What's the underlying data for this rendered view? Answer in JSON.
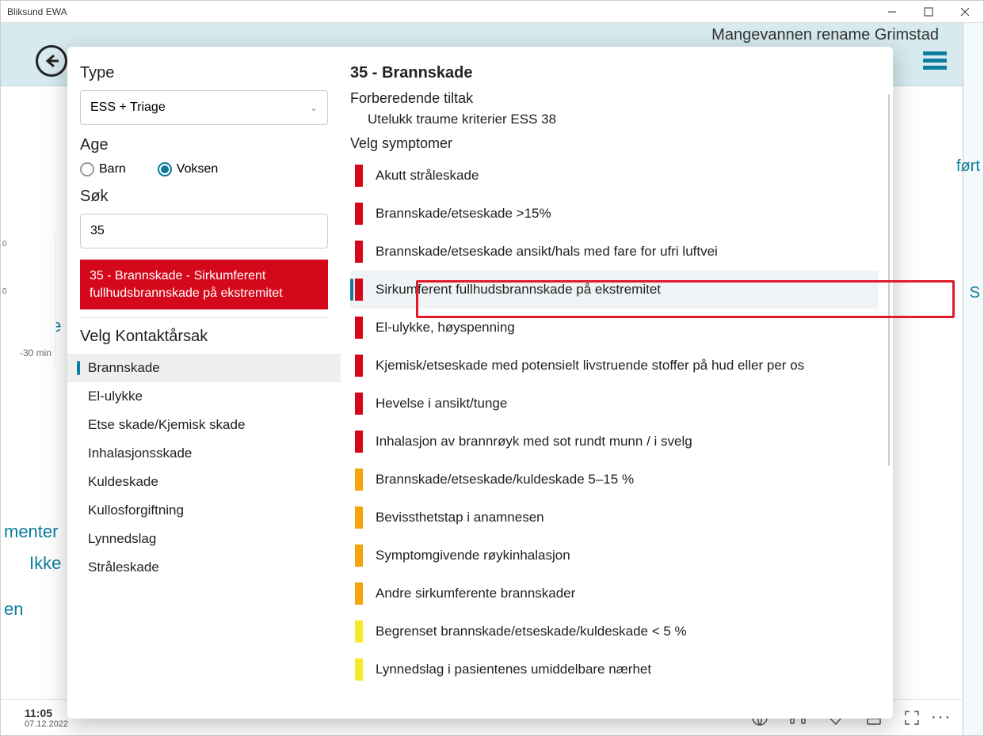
{
  "app": {
    "title": "Bliksund EWA"
  },
  "background": {
    "header_text": "Mangevannen rename Grimstad",
    "frag1": "er",
    "frag2": "Ikke",
    "frag3": "menter",
    "frag4": "Ikke",
    "frag5": "en",
    "frag_right1": "ført",
    "frag_right2": "S",
    "chart_tick0": "0",
    "chart_tick1": "0",
    "chart_axis": "-30 min"
  },
  "clock": {
    "time": "11:05",
    "date": "07.12.2022"
  },
  "left": {
    "type_label": "Type",
    "type_value": "ESS + Triage",
    "age_label": "Age",
    "age_barn": "Barn",
    "age_voksen": "Voksen",
    "sok_label": "Søk",
    "sok_value": "35",
    "result_text": "35 - Brannskade - Sirkumferent fullhudsbrannskade på ekstremitet",
    "contact_label": "Velg Kontaktårsak",
    "contacts": [
      "Brannskade",
      "El-ulykke",
      "Etse skade/Kjemisk skade",
      "Inhalasjonsskade",
      "Kuldeskade",
      "Kullosforgiftning",
      "Lynnedslag",
      "Stråleskade"
    ]
  },
  "right": {
    "title": "35 - Brannskade",
    "prep_label": "Forberedende tiltak",
    "prep_item": "Utelukk traume kriterier ESS 38",
    "symptom_label": "Velg symptomer",
    "symptoms": [
      {
        "color": "red",
        "label": "Akutt stråleskade"
      },
      {
        "color": "red",
        "label": "Brannskade/etseskade  >15%"
      },
      {
        "color": "red",
        "label": "Brannskade/etseskade ansikt/hals med fare for ufri luftvei"
      },
      {
        "color": "red",
        "label": "Sirkumferent fullhudsbrannskade på ekstremitet"
      },
      {
        "color": "red",
        "label": "El-ulykke, høyspenning"
      },
      {
        "color": "red",
        "label": "Kjemisk/etseskade med potensielt livstruende stoffer på hud eller per os"
      },
      {
        "color": "red",
        "label": "Hevelse i ansikt/tunge"
      },
      {
        "color": "red",
        "label": "Inhalasjon av brannrøyk med sot rundt munn / i svelg"
      },
      {
        "color": "orange",
        "label": "Brannskade/etseskade/kuldeskade 5–15 %"
      },
      {
        "color": "orange",
        "label": "Bevissthetstap i anamnesen"
      },
      {
        "color": "orange",
        "label": "Symptomgivende røykinhalasjon"
      },
      {
        "color": "orange",
        "label": "Andre sirkumferente brannskader"
      },
      {
        "color": "yellow",
        "label": "Begrenset brannskade/etseskade/kuldeskade < 5 %"
      },
      {
        "color": "yellow",
        "label": "Lynnedslag i pasientenes umiddelbare nærhet"
      }
    ]
  }
}
